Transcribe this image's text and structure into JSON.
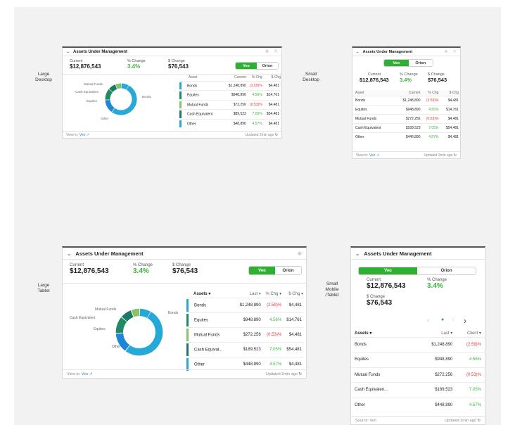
{
  "labels": {
    "large_desktop": "Large\nDesktop",
    "small_desktop": "Small\nDesktop",
    "large_tablet": "Large\nTablet",
    "small_mobile": "Small\nMobile\n/Tablet"
  },
  "widget": {
    "title": "Assets Under Management",
    "current_label": "Current",
    "current_value": "$12,876,543",
    "pct_label": "% Change",
    "pct_value": "3.4%",
    "dollar_label": "$ Change",
    "dollar_value": "$76,543",
    "toggle_on": "Veo",
    "toggle_off": "Orion",
    "view_in_label": "View in:",
    "view_in_link": "Veo",
    "source_label": "Source: Veo",
    "updated": "Updated 2min ago"
  },
  "columns": {
    "asset": "Asset",
    "current": "Current",
    "pct": "% Chg",
    "dollar": "$ Chg",
    "assets_sort": "Assets ▾",
    "last_sort": "Last ▾",
    "pct_sort": "% Chg ▾",
    "dollar_sort": "$ Chg ▾",
    "client_sort": "Client ▾"
  },
  "rows": [
    {
      "name": "Bonds",
      "short": "Bonds",
      "current": "$1,248,890",
      "pct": "(2.59)%",
      "dollar": "$4,481",
      "neg": true,
      "color": "#27a9d8"
    },
    {
      "name": "Equites",
      "short": "Equites",
      "current": "$948,890",
      "pct": "4.56%",
      "dollar": "$14,761",
      "neg": false,
      "color": "#1f8a63"
    },
    {
      "name": "Mutual Funds",
      "short": "Mutual Funds",
      "current": "$72,256",
      "pct": "(0.53)%",
      "dollar": "$4,481",
      "neg": true,
      "color": "#8cc06a"
    },
    {
      "name": "Cash Equivalent",
      "short": "Cash Equival...",
      "current": "$89,523",
      "pct": "7.05%",
      "dollar": "$54,481",
      "neg": false,
      "color": "#1a7a66"
    },
    {
      "name": "Other",
      "short": "Other",
      "current": "$48,890",
      "pct": "4.57%",
      "dollar": "$4,481",
      "neg": false,
      "color": "#27a9d8"
    }
  ],
  "rows_small": [
    {
      "name": "Bonds",
      "current": "$1,248,890",
      "pct": "(2.59)%",
      "dollar": "$4,481",
      "neg": true
    },
    {
      "name": "Equites",
      "current": "$948,890",
      "pct": "4.56%",
      "dollar": "$14,761",
      "neg": false
    },
    {
      "name": "Mutual Funds",
      "current": "$272,256",
      "pct": "(0.53)%",
      "dollar": "$4,481",
      "neg": true
    },
    {
      "name": "Cash Equivalent",
      "current": "$189,523",
      "pct": "7.05%",
      "dollar": "$54,481",
      "neg": false
    },
    {
      "name": "Other",
      "current": "$446,890",
      "pct": "4.57%",
      "dollar": "$4,481",
      "neg": false
    }
  ],
  "rows_tablet": [
    {
      "name": "Bonds",
      "current": "$1,248,890",
      "pct": "(2.59)%",
      "dollar": "$4,481",
      "neg": true,
      "color": "#27a9d8"
    },
    {
      "name": "Equites",
      "current": "$948,890",
      "pct": "4.56%",
      "dollar": "$14,761",
      "neg": false,
      "color": "#1f8a63"
    },
    {
      "name": "Mutual Funds",
      "current": "$272,256",
      "pct": "(0.53)%",
      "dollar": "$4,481",
      "neg": true,
      "color": "#8cc06a"
    },
    {
      "name": "Cash Equivalent",
      "short": "Cash Equival...",
      "current": "$189,523",
      "pct": "7.05%",
      "dollar": "$54,481",
      "neg": false,
      "color": "#1a7a66"
    },
    {
      "name": "Other",
      "current": "$448,890",
      "pct": "4.57%",
      "dollar": "$4,481",
      "neg": false,
      "color": "#27a9d8"
    }
  ],
  "rows_mobile": [
    {
      "name": "Bonds",
      "current": "$1,248,890",
      "pct": "(2.59)%",
      "neg": true
    },
    {
      "name": "Equites",
      "current": "$948,890",
      "pct": "4.56%",
      "neg": false
    },
    {
      "name": "Mutual Funds",
      "current": "$272,256",
      "pct": "(0.53)%",
      "neg": true
    },
    {
      "name": "Cash Equivalen...",
      "current": "$189,523",
      "pct": "7.05%",
      "neg": false
    },
    {
      "name": "Other",
      "current": "$448,890",
      "pct": "4.57%",
      "neg": false
    }
  ],
  "donut": {
    "labels": [
      "Mutual Funds",
      "Cash Equivalent",
      "Equites",
      "Bonds",
      "Other"
    ],
    "segments": [
      {
        "label": "Bonds",
        "value": 52,
        "color": "#27a9d8"
      },
      {
        "label": "Other",
        "value": 14,
        "color": "#1e86d6"
      },
      {
        "label": "Equites",
        "value": 12,
        "color": "#1f8a63"
      },
      {
        "label": "Cash Equivalent",
        "value": 8,
        "color": "#1a7a66"
      },
      {
        "label": "Mutual Funds",
        "value": 6,
        "color": "#8cc06a"
      },
      {
        "label": "Bonds-tail",
        "value": 8,
        "color": "#27a9d8"
      }
    ]
  }
}
